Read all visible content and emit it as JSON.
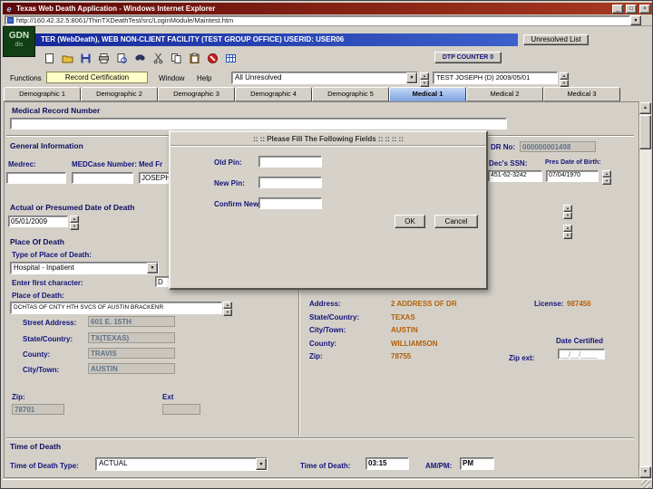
{
  "icons": {
    "minimize": "_",
    "maximize": "□",
    "close": "×",
    "down": "▼",
    "up": "▲",
    "ie_logo": "e"
  },
  "window": {
    "title": "Texas Web Death Application - Windows Internet Explorer",
    "address": "http://160.42.32.5:8061/ThinTXDeathTest/src/LoginModule/Maintest.htm"
  },
  "app_header": {
    "logo_line1": "GDN",
    "logo_line2": "dis",
    "title": "TER (WebDeath), WEB NON-CLIENT FACILITY (TEST GROUP OFFICE) USERID: USER06",
    "unresolved_button": "Unresolved List",
    "dtp_counter": "DTP COUNTER 0"
  },
  "menubar": {
    "items": [
      "Functions",
      "Record Certification",
      "Window",
      "Help"
    ],
    "filter_value": "All Unresolved",
    "record_value": "TEST JOSEPH (D) 2009/05/01"
  },
  "tabs": [
    "Demographic 1",
    "Demographic 2",
    "Demographic 3",
    "Demographic 4",
    "Demographic 5",
    "Medical 1",
    "Medical 2",
    "Medical 3"
  ],
  "dialog": {
    "title": ":: :: Please Fill The Following Fields :: :: :: ::",
    "old_pin_label": "Old Pin:",
    "new_pin_label": "New Pin:",
    "confirm_pin_label": "Confirm New Pin:",
    "ok_button": "OK",
    "cancel_button": "Cancel"
  },
  "form": {
    "medical_record_number_label": "Medical Record Number",
    "general": {
      "section_title": "General Information",
      "medrec_label": "Medrec:",
      "medcase_label": "MEDCase Number:",
      "medfr_label": "Med Fr",
      "name_value": "JOSEPH",
      "drno_label": "DR No:",
      "drno_value": "000000001498",
      "ssn_label": "Dec's SSN:",
      "ssn_value": "451-62-3242",
      "dob_label": "Pres Date of Birth:",
      "dob_value": "07/04/1970"
    },
    "death_date": {
      "section_title": "Actual or Presumed Date of Death",
      "value": "05/01/2009"
    },
    "place": {
      "section_title": "Place Of Death",
      "type_label": "Type of Place of Death:",
      "type_value": "Hospital - Inpatient",
      "first_char_label": "Enter first character:",
      "first_char_value": "D",
      "place_label": "Place of Death:",
      "place_value": "DCHTAS OF CNTY HTH SVCS OF AUSTIN BRACKENR",
      "street_label": "Street Address:",
      "street_value": "601 E. 15TH",
      "state_label": "State/Country:",
      "state_value": "TX(TEXAS)",
      "county_label": "County:",
      "county_value": "TRAVIS",
      "city_label": "City/Town:",
      "city_value": "AUSTIN",
      "zip_label": "Zip:",
      "zip_value": "78701",
      "ext_label": "Ext"
    },
    "certifier": {
      "address_label": "Address:",
      "address_value": "2 ADDRESS OF DR",
      "license_label": "License:",
      "license_value": "987456",
      "state_label": "State/Country:",
      "state_value": "TEXAS",
      "city_label": "City/Town:",
      "city_value": "AUSTIN",
      "county_label": "County:",
      "county_value": "WILLIAMSON",
      "zip_label": "Zip:",
      "zip_value": "78755",
      "zip_ext_label": "Zip ext:",
      "date_certified_label": "Date Certified",
      "date_certified_value": "__/__/____"
    },
    "time": {
      "section_title": "Time of Death",
      "type_label": "Time of Death Type:",
      "type_value": "ACTUAL",
      "time_label": "Time of Death:",
      "time_value": "03:15",
      "ampm_label": "AM/PM:",
      "ampm_value": "PM"
    }
  }
}
